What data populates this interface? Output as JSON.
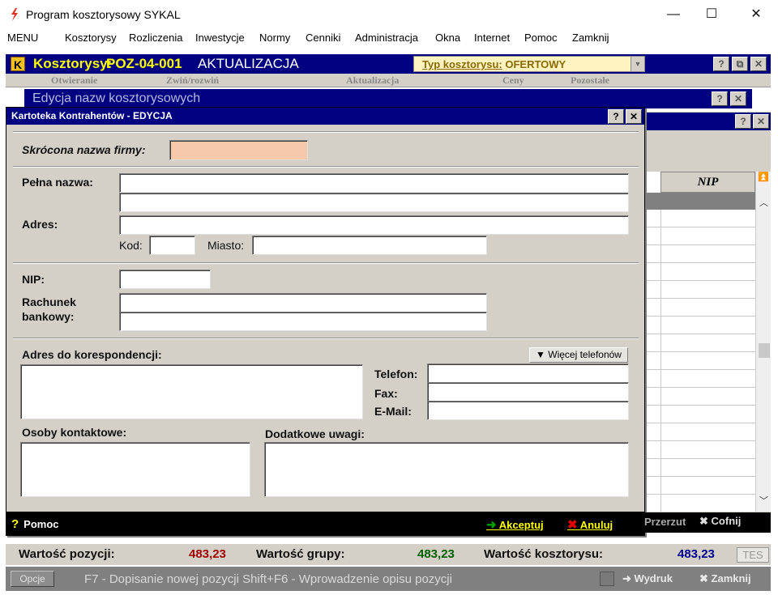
{
  "window": {
    "title": "Program kosztorysowy SYKAL",
    "controls": {
      "minimize": "—",
      "maximize": "☐",
      "close": "✕"
    }
  },
  "menu": [
    "MENU",
    "Kosztorysy",
    "Rozliczenia",
    "Inwestycje",
    "Normy",
    "Cenniki",
    "Administracja",
    "Okna",
    "Internet",
    "Pomoc",
    "Zamknij"
  ],
  "kosztorys": {
    "badge": "K",
    "label": "Kosztorysy:",
    "code": "POZ-04-001",
    "mode": "AKTUALIZACJA",
    "type_label": "Typ kosztorysu:",
    "type_value": "OFERTOWY"
  },
  "bg_tabs": [
    "Otwieranie",
    "Zwiń/rozwiń",
    "Aktualizacja",
    "Ceny",
    "Pozostałe"
  ],
  "edycja_title": "Edycja nazw kosztorysowych",
  "grid": {
    "nip_header": "NIP"
  },
  "dialog": {
    "title": "Kartoteka Kontrahentów - EDYCJA",
    "help_btn": "?",
    "close_btn": "✕",
    "fields": {
      "short_name_label": "Skrócona nazwa firmy:",
      "full_name_label": "Pełna nazwa:",
      "address_label": "Adres:",
      "kod_label": "Kod:",
      "miasto_label": "Miasto:",
      "nip_label": "NIP:",
      "bank_label_1": "Rachunek",
      "bank_label_2": "bankowy:",
      "corr_address_label": "Adres do korespondencji:",
      "more_phones_btn": "Więcej telefonów",
      "phone_label": "Telefon:",
      "fax_label": "Fax:",
      "email_label": "E-Mail:",
      "contacts_label": "Osoby kontaktowe:",
      "notes_label": "Dodatkowe uwagi:"
    },
    "footer": {
      "help": "Pomoc",
      "accept": "Akceptuj",
      "cancel": "Anuluj"
    }
  },
  "side_actions": {
    "przerzut": "Przerzut",
    "cofnij": "Cofnij"
  },
  "values": {
    "pozycji_label": "Wartość pozycji:",
    "pozycji_value": "483,23",
    "grupy_label": "Wartość grupy:",
    "grupy_value": "483,23",
    "kosztorysu_label": "Wartość kosztorysu:",
    "kosztorysu_value": "483,23",
    "tes": "TES"
  },
  "bottom": {
    "opcje": "Opcje",
    "hint": "F7 - Dopisanie nowej pozycji   Shift+F6 - Wprowadzenie opisu pozycji",
    "wydruk": "Wydruk",
    "zamknij": "Zamknij"
  },
  "colors": {
    "navy": "#000080",
    "field_highlight": "#f4c8a8",
    "value_red": "#a00000",
    "value_green": "#006000",
    "value_blue": "#000090",
    "accept_green": "#00a000",
    "cancel_red": "#e00000"
  }
}
